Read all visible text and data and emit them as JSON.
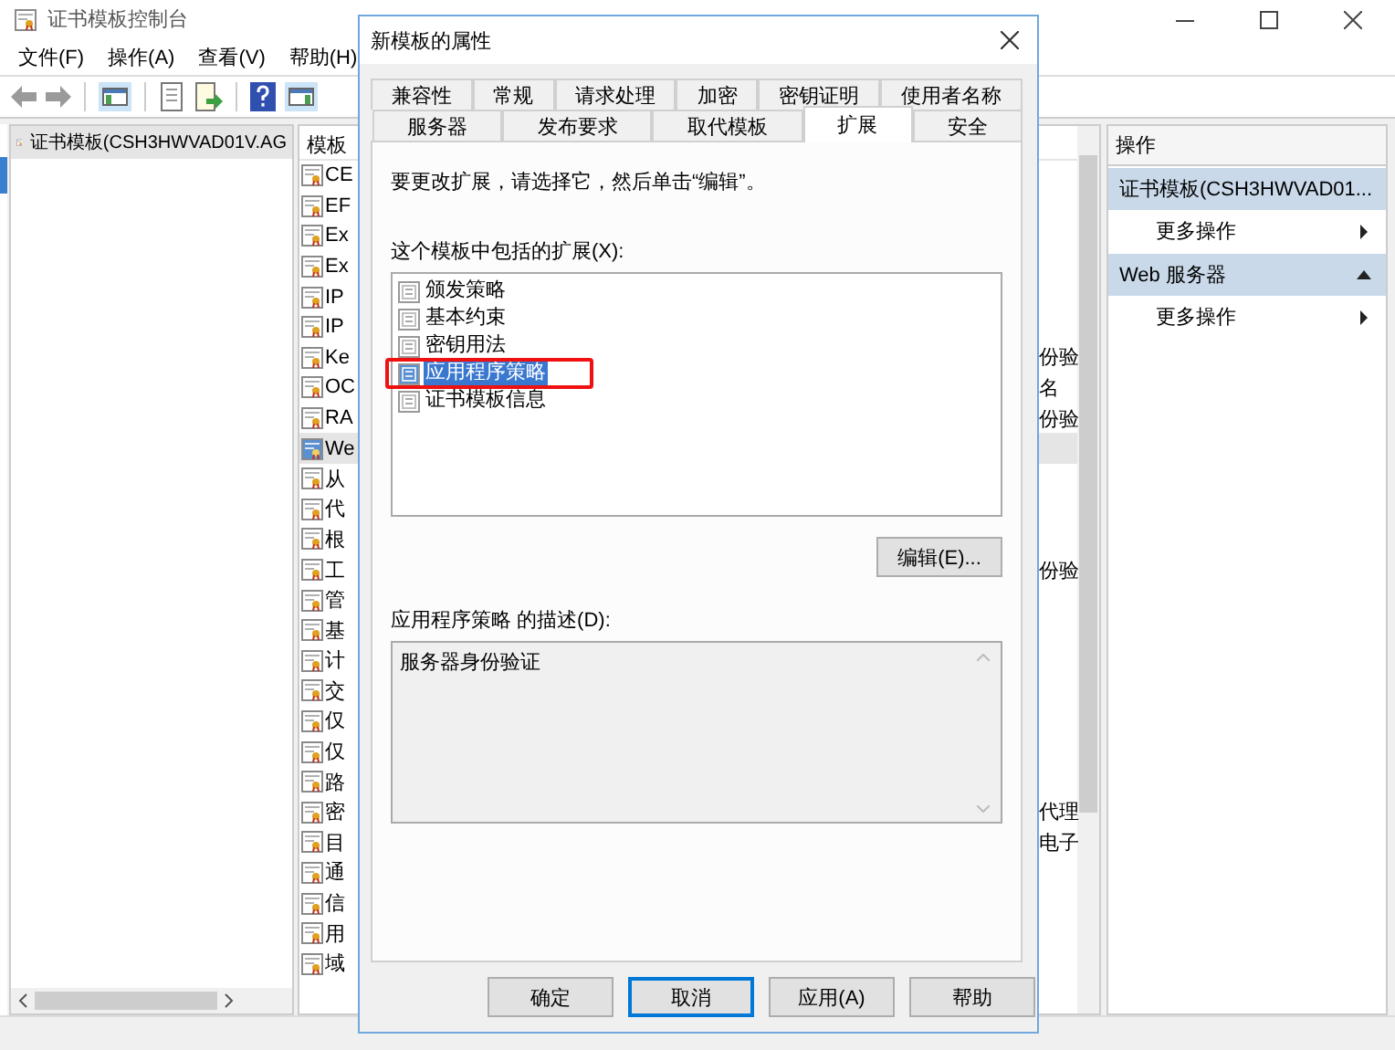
{
  "window": {
    "title": "证书模板控制台"
  },
  "menu": [
    "文件(F)",
    "操作(A)",
    "查看(V)",
    "帮助(H)"
  ],
  "tree": {
    "items": [
      {
        "label": "证书模板(CSH3HWVAD01V.AG",
        "selected": true
      }
    ]
  },
  "list": {
    "header": "模板",
    "rows": [
      {
        "name": "CE",
        "selected": false
      },
      {
        "name": "EF",
        "selected": false
      },
      {
        "name": "Ex",
        "selected": false
      },
      {
        "name": "Ex",
        "selected": false
      },
      {
        "name": "IP",
        "selected": false
      },
      {
        "name": "IP",
        "selected": false
      },
      {
        "name": "Ke",
        "column_2": "份验",
        "selected": false
      },
      {
        "name": "OC",
        "column_2": "名",
        "selected": false
      },
      {
        "name": "RA",
        "column_2": "份验",
        "selected": false
      },
      {
        "name": "We",
        "selected": true
      },
      {
        "name": "从",
        "selected": false
      },
      {
        "name": "代",
        "selected": false
      },
      {
        "name": "根",
        "selected": false
      },
      {
        "name": "工",
        "column_2": "份验",
        "selected": false
      },
      {
        "name": "管",
        "selected": false
      },
      {
        "name": "基",
        "selected": false
      },
      {
        "name": "计",
        "selected": false
      },
      {
        "name": "交",
        "selected": false
      },
      {
        "name": "仅",
        "selected": false
      },
      {
        "name": "仅",
        "selected": false
      },
      {
        "name": "路",
        "selected": false
      },
      {
        "name": "密",
        "column_2": "代理",
        "selected": false
      },
      {
        "name": "目",
        "column_2": "电子",
        "selected": false
      },
      {
        "name": "通",
        "selected": false
      },
      {
        "name": "信",
        "selected": false
      },
      {
        "name": "用",
        "selected": false
      },
      {
        "name": "域",
        "selected": false
      }
    ]
  },
  "actions": {
    "title": "操作",
    "groups": [
      {
        "label": "证书模板(CSH3HWVAD01...",
        "items": [
          "更多操作"
        ]
      },
      {
        "label": "Web 服务器",
        "items": [
          "更多操作"
        ]
      }
    ]
  },
  "dialog": {
    "title": "新模板的属性",
    "tab_rows": [
      [
        {
          "label": "兼容性",
          "selected": false
        },
        {
          "label": "常规",
          "selected": false
        },
        {
          "label": "请求处理",
          "selected": false
        },
        {
          "label": "加密",
          "selected": false
        },
        {
          "label": "密钥证明",
          "selected": false
        },
        {
          "label": "使用者名称",
          "selected": false
        }
      ],
      [
        {
          "label": "服务器",
          "selected": false
        },
        {
          "label": "发布要求",
          "selected": false
        },
        {
          "label": "取代模板",
          "selected": false
        },
        {
          "label": "扩展",
          "selected": true
        },
        {
          "label": "安全",
          "selected": false
        }
      ]
    ],
    "instruction": "要更改扩展，请选择它，然后单击“编辑”。",
    "extensions_label": "这个模板中包括的扩展(X):",
    "extensions": [
      {
        "label": "颁发策略",
        "selected": false
      },
      {
        "label": "基本约束",
        "selected": false
      },
      {
        "label": "密钥用法",
        "selected": false
      },
      {
        "label": "应用程序策略",
        "selected": true
      },
      {
        "label": "证书模板信息",
        "selected": false
      }
    ],
    "edit_button": "编辑(E)...",
    "description_label": "应用程序策略 的描述(D):",
    "description": "服务器身份验证",
    "buttons": [
      {
        "label": "确定",
        "focused": false
      },
      {
        "label": "取消",
        "focused": true
      },
      {
        "label": "应用(A)",
        "focused": false
      },
      {
        "label": "帮助",
        "focused": false
      }
    ]
  }
}
